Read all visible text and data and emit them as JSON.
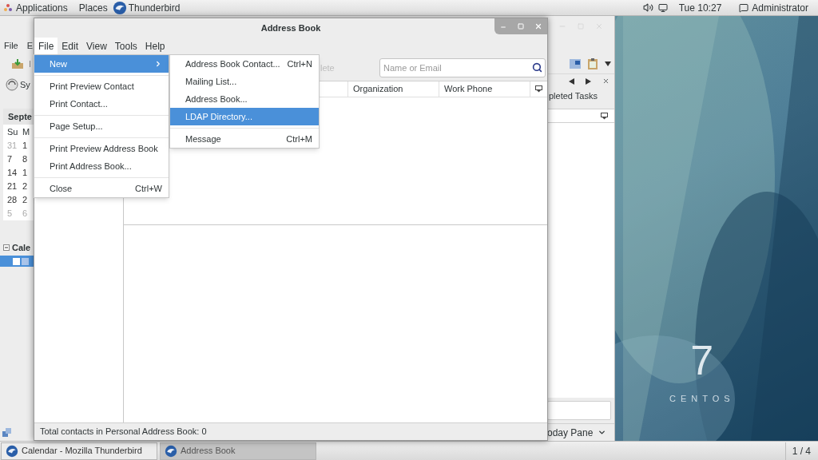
{
  "top_bar": {
    "menus": [
      "Applications",
      "Places"
    ],
    "app_name": "Thunderbird",
    "clock": "Tue 10:27",
    "user": "Administrator"
  },
  "desktop": {
    "logo_number": "7",
    "logo_word": "CENTOS"
  },
  "calendar_window": {
    "menus": [
      "File",
      "E"
    ],
    "toolbar_label": "I",
    "sync_label": "Sy",
    "minimonth": {
      "month": "Septe",
      "weekdays": [
        "Su",
        "M"
      ],
      "days": [
        [
          {
            "day": "31",
            "other_month": true
          },
          {
            "day": "1",
            "other_month": false
          }
        ],
        [
          {
            "day": "7",
            "other_month": false
          },
          {
            "day": "8",
            "other_month": false
          }
        ],
        [
          {
            "day": "14",
            "other_month": false
          },
          {
            "day": "1",
            "other_month": false
          }
        ],
        [
          {
            "day": "21",
            "other_month": false
          },
          {
            "day": "2",
            "other_month": false
          }
        ],
        [
          {
            "day": "28",
            "other_month": false
          },
          {
            "day": "2",
            "other_month": false
          }
        ],
        [
          {
            "day": "5",
            "other_month": true
          },
          {
            "day": "6",
            "other_month": true
          }
        ]
      ]
    },
    "calendars_header": "Cale",
    "calendars": [
      {
        "selected": true
      }
    ],
    "tasks_tab": "pleted Tasks",
    "today_pane": "oday Pane"
  },
  "address_book": {
    "title": "Address Book",
    "menus": [
      {
        "label": "File",
        "selected": true
      },
      {
        "label": "Edit",
        "selected": false
      },
      {
        "label": "View",
        "selected": false
      },
      {
        "label": "Tools",
        "selected": false
      },
      {
        "label": "Help",
        "selected": false
      }
    ],
    "toolbar": [
      {
        "label": "lete",
        "disabled": true
      }
    ],
    "search": {
      "placeholder": "Name or Email"
    },
    "columns": [
      "Organization",
      "Work Phone"
    ],
    "status": "Total contacts in Personal Address Book: 0"
  },
  "file_menu": [
    {
      "kind": "item",
      "label": "New",
      "selected": true,
      "submenu": true
    },
    {
      "kind": "separator"
    },
    {
      "kind": "item",
      "label": "Print Preview Contact",
      "selected": false
    },
    {
      "kind": "item",
      "label": "Print Contact...",
      "selected": false
    },
    {
      "kind": "separator"
    },
    {
      "kind": "item",
      "label": "Page Setup...",
      "selected": false
    },
    {
      "kind": "separator"
    },
    {
      "kind": "item",
      "label": "Print Preview Address Book",
      "selected": false
    },
    {
      "kind": "item",
      "label": "Print Address Book...",
      "selected": false
    },
    {
      "kind": "separator"
    },
    {
      "kind": "item",
      "label": "Close",
      "shortcut": "Ctrl+W",
      "selected": false
    }
  ],
  "new_submenu": [
    {
      "kind": "item",
      "label": "Address Book Contact...",
      "shortcut": "Ctrl+N",
      "selected": false
    },
    {
      "kind": "item",
      "label": "Mailing List...",
      "selected": false
    },
    {
      "kind": "item",
      "label": "Address Book...",
      "selected": false
    },
    {
      "kind": "item",
      "label": "LDAP Directory...",
      "selected": true
    },
    {
      "kind": "separator"
    },
    {
      "kind": "item",
      "label": "Message",
      "shortcut": "Ctrl+M",
      "selected": false
    }
  ],
  "taskbar": {
    "tasks": [
      {
        "label": "Calendar - Mozilla Thunderbird",
        "selected": false
      },
      {
        "label": "Address Book",
        "selected": true
      }
    ],
    "workspace": "1 / 4"
  }
}
